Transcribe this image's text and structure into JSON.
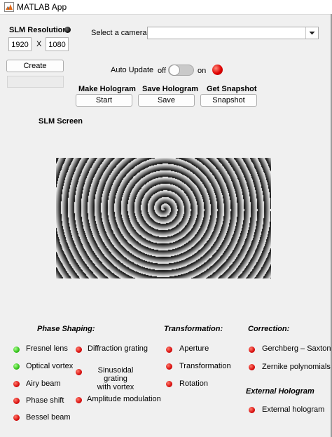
{
  "window": {
    "title": "MATLAB App"
  },
  "slm": {
    "resolution_label": "SLM Resolution",
    "width": "1920",
    "separator": "X",
    "height": "1080",
    "create_label": "Create",
    "status_text": ""
  },
  "camera": {
    "label": "Select a camera",
    "selected": ""
  },
  "auto_update": {
    "label": "Auto Update",
    "off_label": "off",
    "on_label": "on",
    "state": "off",
    "lamp_color": "#e00000"
  },
  "actions": {
    "make_hologram": {
      "label": "Make Hologram",
      "button": "Start"
    },
    "save_hologram": {
      "label": "Save Hologram",
      "button": "Save"
    },
    "get_snapshot": {
      "label": "Get Snapshot",
      "button": "Snapshot"
    }
  },
  "screen": {
    "title": "SLM Screen"
  },
  "sections": {
    "phase_shaping": {
      "title": "Phase Shaping:",
      "col1": [
        {
          "label": "Fresnel lens",
          "state": "green"
        },
        {
          "label": "Optical vortex",
          "state": "green"
        },
        {
          "label": "Airy beam",
          "state": "red"
        },
        {
          "label": "Phase shift",
          "state": "red"
        },
        {
          "label": "Bessel beam",
          "state": "red"
        }
      ],
      "col2": [
        {
          "label": "Diffraction grating",
          "state": "red"
        },
        {
          "label_line1": "Sinusoidal grating",
          "label_line2": "with vortex",
          "state": "red"
        },
        {
          "label": "Amplitude modulation",
          "state": "red"
        }
      ]
    },
    "transformation": {
      "title": "Transformation:",
      "items": [
        {
          "label": "Aperture",
          "state": "red"
        },
        {
          "label": "Transformation",
          "state": "red"
        },
        {
          "label": "Rotation",
          "state": "red"
        }
      ]
    },
    "correction": {
      "title": "Correction:",
      "items": [
        {
          "label": "Gerchberg – Saxton",
          "state": "red"
        },
        {
          "label": "Zernike polynomials",
          "state": "red"
        }
      ]
    },
    "external": {
      "title": "External Hologram",
      "items": [
        {
          "label": "External hologram",
          "state": "red"
        }
      ]
    }
  },
  "colors": {
    "lamp_red": "#e00000",
    "lamp_green": "#35c21c",
    "background": "#f0f0f0"
  }
}
